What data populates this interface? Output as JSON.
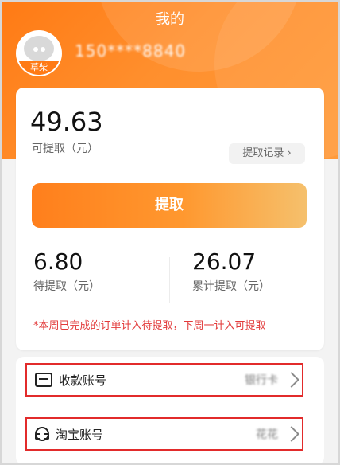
{
  "header": {
    "title": "我的",
    "username_masked": "150****8840",
    "avatar_badge": "草柴"
  },
  "balance": {
    "available_amount": "49.63",
    "available_label": "可提取（元）",
    "record_label": "提取记录",
    "withdraw_label": "提取"
  },
  "stats": {
    "pending_amount": "6.80",
    "pending_label": "待提取（元）",
    "total_amount": "26.07",
    "total_label": "累计提取（元）"
  },
  "notice": "*本周已完成的订单计入待提取，下周一计入可提取",
  "accounts": [
    {
      "label": "收款账号",
      "value": "银行卡"
    },
    {
      "label": "淘宝账号",
      "value": "花花"
    }
  ]
}
